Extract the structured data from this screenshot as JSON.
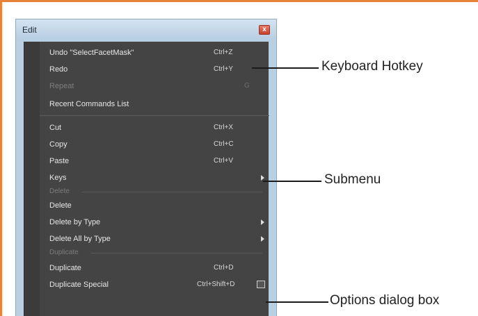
{
  "window": {
    "title": "Edit",
    "close_glyph": "x"
  },
  "menu": {
    "undo": {
      "label": "Undo \"SelectFacetMask\"",
      "shortcut": "Ctrl+Z"
    },
    "redo": {
      "label": "Redo",
      "shortcut": "Ctrl+Y"
    },
    "repeat": {
      "label": "Repeat",
      "shortcut": "G"
    },
    "recent": {
      "label": "Recent Commands List"
    },
    "cut": {
      "label": "Cut",
      "shortcut": "Ctrl+X"
    },
    "copy": {
      "label": "Copy",
      "shortcut": "Ctrl+C"
    },
    "paste": {
      "label": "Paste",
      "shortcut": "Ctrl+V"
    },
    "keys": {
      "label": "Keys"
    },
    "section_delete": "Delete",
    "delete": {
      "label": "Delete"
    },
    "delete_by_type": {
      "label": "Delete by Type"
    },
    "delete_all_by_type": {
      "label": "Delete All by Type"
    },
    "section_duplicate": "Duplicate",
    "duplicate": {
      "label": "Duplicate",
      "shortcut": "Ctrl+D"
    },
    "duplicate_special": {
      "label": "Duplicate Special",
      "shortcut": "Ctrl+Shift+D"
    }
  },
  "annotations": {
    "keyboard_hotkey": "Keyboard Hotkey",
    "submenu": "Submenu",
    "options_dialog": "Options dialog box"
  }
}
